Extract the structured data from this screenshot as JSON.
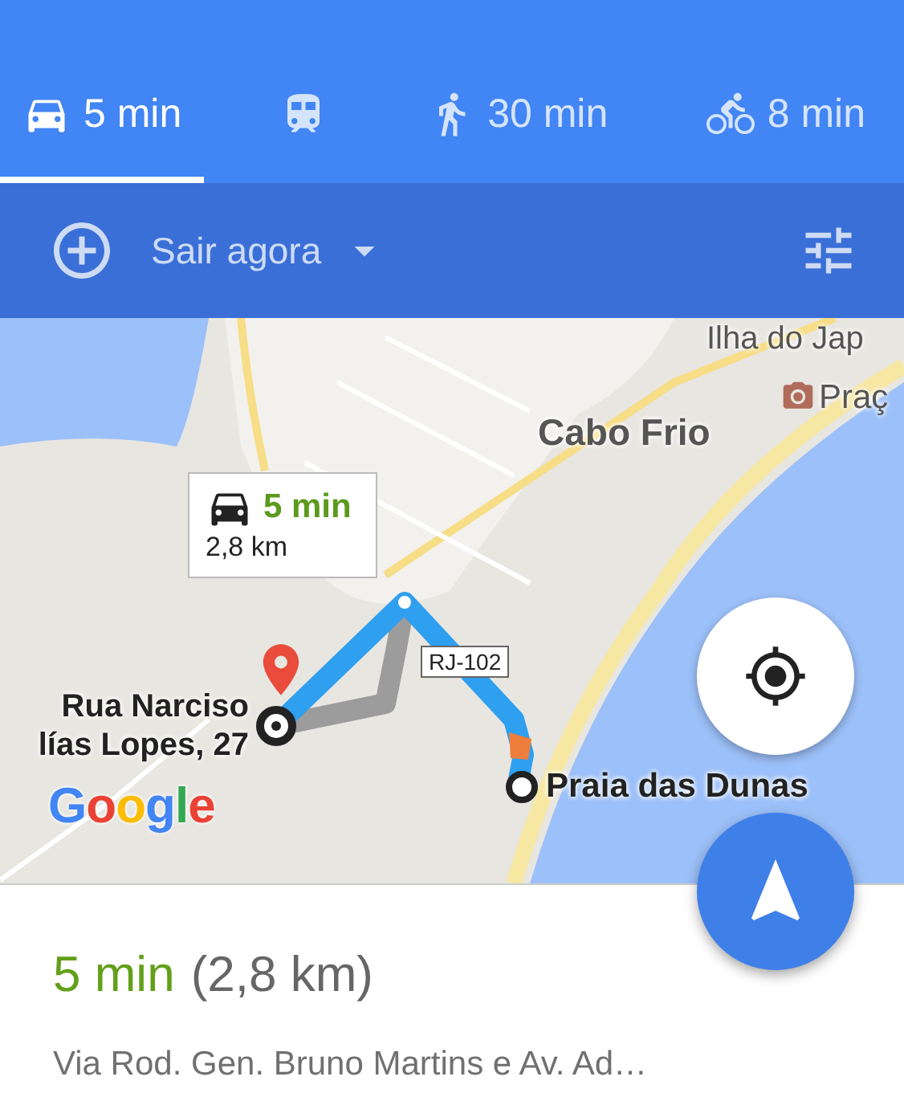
{
  "tabs": [
    {
      "kind": "car",
      "label": "5 min",
      "selected": true
    },
    {
      "kind": "transit",
      "selected": false
    },
    {
      "kind": "walk",
      "label": "30 min",
      "selected": false
    },
    {
      "kind": "bike",
      "label": "8 min",
      "selected": false
    }
  ],
  "options_bar": {
    "departure": "Sair agora"
  },
  "map": {
    "area_label": "Ilha do Jap",
    "poi_label": "Praç",
    "city_label": "Cabo Frio",
    "route_card": {
      "duration": "5 min",
      "distance": "2,8 km"
    },
    "road_sign": "RJ-102",
    "origin_lines": [
      "Rua Narciso",
      "lías Lopes, 27"
    ],
    "destination": "Praia das Dunas",
    "logo": "Google"
  },
  "summary": {
    "duration": "5 min",
    "distance": "(2,8 km)",
    "via": "Via Rod. Gen. Bruno Martins e Av. Ad…"
  }
}
